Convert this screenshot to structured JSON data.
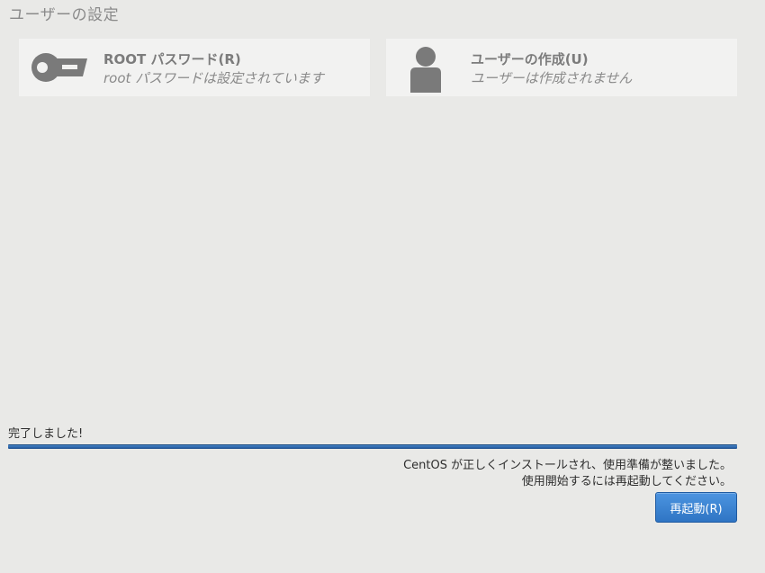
{
  "section_title": "ユーザーの設定",
  "spokes": {
    "root": {
      "icon": "key-icon",
      "title": "ROOT パスワード(R)",
      "status": "root パスワードは設定されています"
    },
    "user": {
      "icon": "user-icon",
      "title": "ユーザーの作成(U)",
      "status": "ユーザーは作成されません"
    }
  },
  "progress": {
    "label": "完了しました!",
    "fraction": 1.0
  },
  "messages": {
    "line1": "CentOS が正しくインストールされ、使用準備が整いました。",
    "line2": "使用開始するには再起動してください。"
  },
  "buttons": {
    "reboot": "再起動(R)"
  },
  "colors": {
    "accent": "#2f75c4",
    "background": "#e9e9e7"
  }
}
